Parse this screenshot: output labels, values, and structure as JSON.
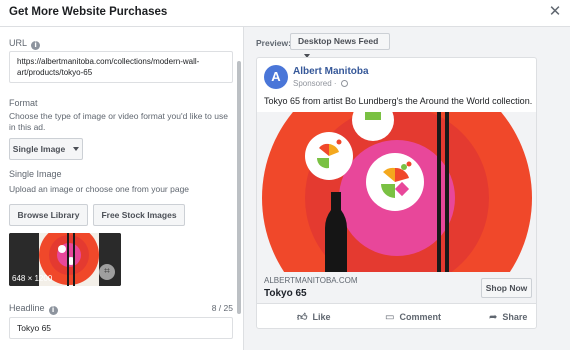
{
  "dialog": {
    "title": "Get More Website Purchases",
    "close_icon": "close-icon"
  },
  "form": {
    "url_label": "URL",
    "url_value": "https://albertmanitoba.com/collections/modern-wall-art/products/tokyo-65",
    "format_label": "Format",
    "format_desc": "Choose the type of image or video format you'd like to use in this ad.",
    "format_selected": "Single Image",
    "single_image_label": "Single Image",
    "upload_desc": "Upload an image or choose one from your page",
    "browse_label": "Browse Library",
    "stock_label": "Free Stock Images",
    "thumb_dims": "648 × 1200",
    "headline_label": "Headline",
    "headline_counter": "8 / 25",
    "headline_value": "Tokyo 65"
  },
  "preview": {
    "label": "Preview:",
    "placement": "Desktop News Feed",
    "page_initial": "A",
    "page_name": "Albert Manitoba",
    "sponsored": "Sponsored · ",
    "body_text": "Tokyo 65 from artist Bo Lundberg's the Around the World collection.",
    "domain": "ALBERTMANITOBA.COM",
    "link_title": "Tokyo 65",
    "cta_label": "Shop Now",
    "like_label": "Like",
    "comment_label": "Comment",
    "share_label": "Share"
  },
  "colors": {
    "link_blue": "#365899",
    "avatar_blue": "#4a76d8",
    "art_orange": "#f0482a",
    "art_red": "#e43a30",
    "art_pink": "#e8479a"
  }
}
